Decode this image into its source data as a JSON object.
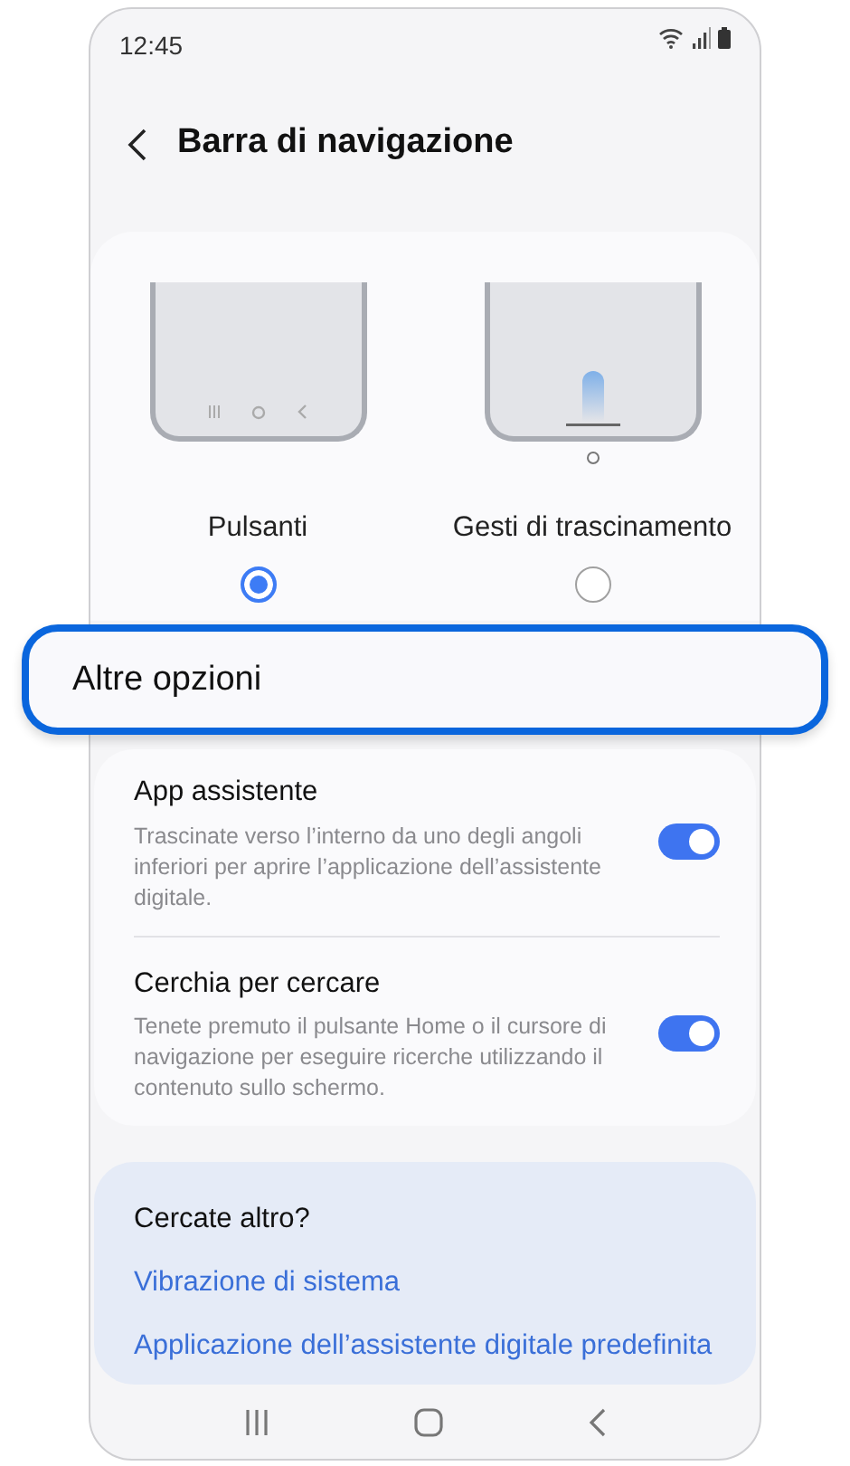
{
  "status_bar": {
    "time": "12:45"
  },
  "header": {
    "title": "Barra di navigazione"
  },
  "nav_options": [
    {
      "kind": "buttons",
      "label": "Pulsanti",
      "selected": true
    },
    {
      "kind": "gestures",
      "label": "Gesti di trascinamento",
      "selected": false
    }
  ],
  "highlighted_item": {
    "label": "Altre opzioni"
  },
  "settings": [
    {
      "title": "App assistente",
      "description": "Trascinate verso l’interno da uno degli angoli inferiori per aprire l’applicazione dell’assistente digitale.",
      "on": true
    },
    {
      "title": "Cerchia per cercare",
      "description": "Tenete premuto il pulsante Home o il cursore di navigazione per eseguire ricerche utilizzando il contenuto sullo schermo.",
      "on": true
    }
  ],
  "suggestions": {
    "title": "Cercate altro?",
    "links": [
      "Vibrazione di sistema",
      "Applicazione dell’assistente digitale predefinita"
    ]
  }
}
